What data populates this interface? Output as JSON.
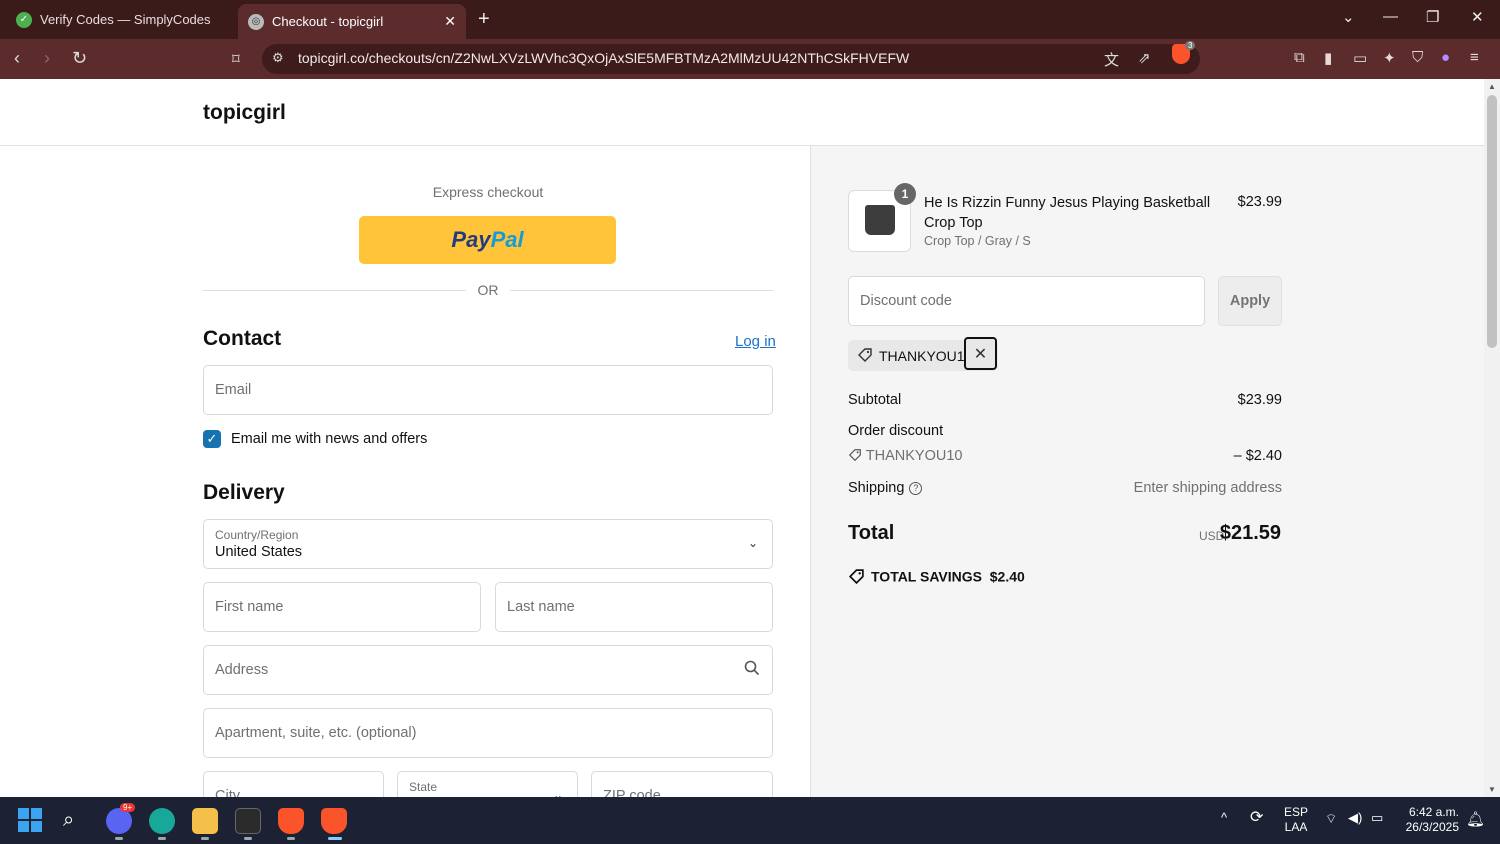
{
  "browser": {
    "tabs": [
      {
        "label": "Verify Codes — SimplyCodes",
        "active": false
      },
      {
        "label": "Checkout - topicgirl",
        "active": true
      }
    ],
    "url": "topicgirl.co/checkouts/cn/Z2NwLXVzLWVhc3QxOjAxSlE5MFBTMzA2MlMzUU42NThCSkFHVEFW",
    "shields_count": "3"
  },
  "shop": {
    "name": "topicgirl"
  },
  "checkout": {
    "express_label": "Express checkout",
    "paypal_part1": "Pay",
    "paypal_part2": "Pal",
    "or_label": "OR",
    "contact_title": "Contact",
    "login_label": "Log in",
    "email_placeholder": "Email",
    "newsletter_label": "Email me with news and offers",
    "newsletter_checked": true,
    "delivery_title": "Delivery",
    "country_label": "Country/Region",
    "country_value": "United States",
    "first_name_placeholder": "First name",
    "last_name_placeholder": "Last name",
    "address_placeholder": "Address",
    "apartment_placeholder": "Apartment, suite, etc. (optional)",
    "city_placeholder": "City",
    "state_label": "State",
    "zip_placeholder": "ZIP code"
  },
  "summary": {
    "product": {
      "quantity": "1",
      "title": "He Is Rizzin Funny Jesus Playing Basketball Crop Top",
      "variant": "Crop Top / Gray / S",
      "price": "$23.99"
    },
    "discount_placeholder": "Discount code",
    "apply_label": "Apply",
    "applied_code": "THANKYOU10",
    "subtotal_label": "Subtotal",
    "subtotal_value": "$23.99",
    "order_discount_label": "Order discount",
    "order_discount_code": "THANKYOU10",
    "order_discount_value": "– $2.40",
    "shipping_label": "Shipping",
    "shipping_value": "Enter shipping address",
    "total_label": "Total",
    "total_currency": "USD",
    "total_value": "$21.59",
    "savings_label": "TOTAL SAVINGS",
    "savings_value": "$2.40"
  },
  "taskbar": {
    "discord_badge": "9+",
    "lang_line1": "ESP",
    "lang_line2": "LAA",
    "time": "6:42 a.m.",
    "date": "26/3/2025"
  },
  "colors": {
    "paypal_yellow": "#ffc439",
    "link_blue": "#1a73c9",
    "checkbox_blue": "#1773b0",
    "browser_frame": "#5c2c2c"
  }
}
